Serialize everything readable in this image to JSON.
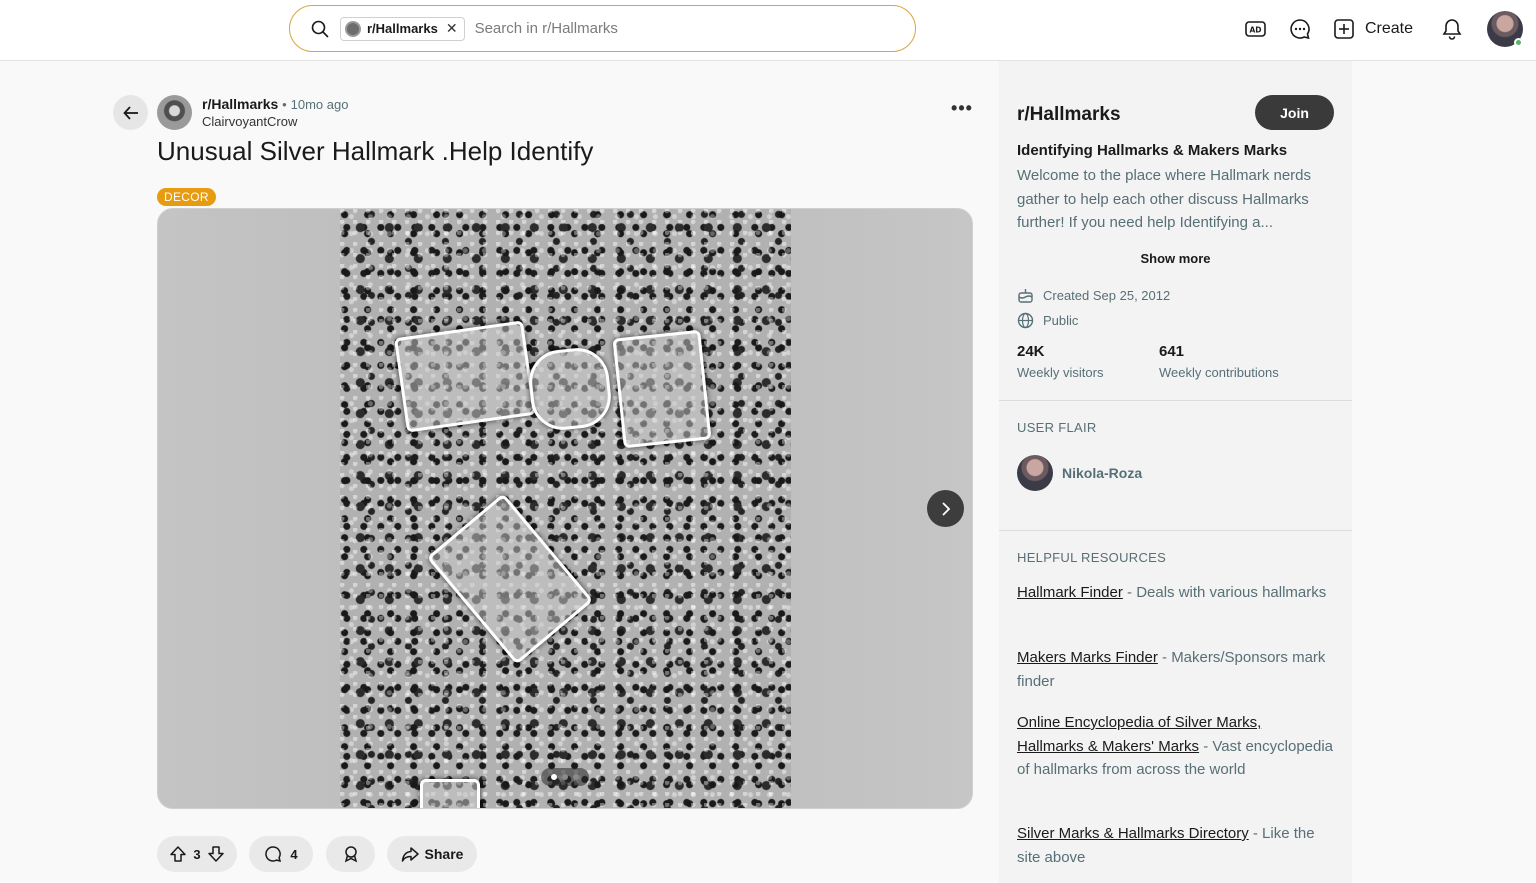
{
  "header": {
    "search_chip": "r/Hallmarks",
    "search_placeholder": "Search in r/Hallmarks",
    "create_label": "Create"
  },
  "post": {
    "subreddit": "r/Hallmarks",
    "separator": "•",
    "time_ago": "10mo ago",
    "author": "ClairvoyantCrow",
    "more": "•••",
    "title": "Unusual Silver Hallmark .Help Identify",
    "flair": "DECOR",
    "gallery_total": 3,
    "gallery_current": 1,
    "upvotes": "3",
    "comments": "4",
    "share_label": "Share"
  },
  "sidebar": {
    "name": "r/Hallmarks",
    "join_label": "Join",
    "heading": "Identifying Hallmarks & Makers Marks",
    "description": "Welcome to the place where Hallmark nerds gather to help each other discuss Hallmarks further! If you need help Identifying a...",
    "show_more": "Show more",
    "created": "Created Sep 25, 2012",
    "visibility": "Public",
    "stats": {
      "visitors_value": "24K",
      "visitors_label": "Weekly visitors",
      "contributions_value": "641",
      "contributions_label": "Weekly contributions"
    },
    "user_flair_title": "USER FLAIR",
    "user_flair_name": "Nikola-Roza",
    "resources_title": "HELPFUL RESOURCES",
    "resources": [
      {
        "link": "Hallmark Finder",
        "text": " - Deals with various hallmarks"
      },
      {
        "link": "Makers Marks Finder",
        "text": " - Makers/Sponsors mark finder"
      },
      {
        "link": "Online Encyclopedia of Silver Marks,",
        "link2": "Hallmarks & Makers' Marks",
        "text": " - Vast encyclopedia of hallmarks from across the world"
      },
      {
        "link": "Silver Marks & Hallmarks Directory",
        "text": " - Like the site above"
      }
    ]
  },
  "colors": {
    "flair": "#e79b10",
    "join": "#3a3a3a",
    "search_border": "#d9a441"
  }
}
